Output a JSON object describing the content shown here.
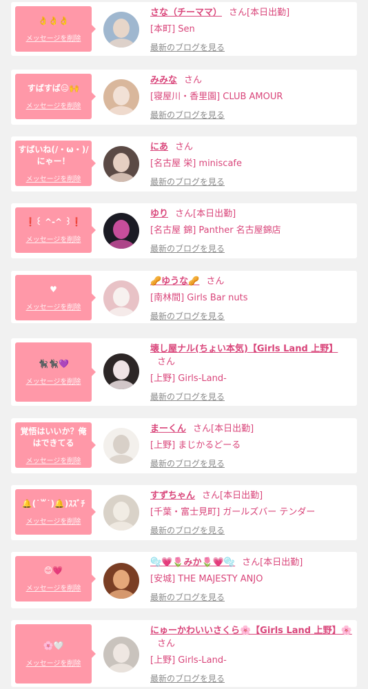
{
  "cards": [
    {
      "message": "👌👌👌",
      "delete_label": "メッセージを削除",
      "name": "さな（チーママ）",
      "san": "さん",
      "status": "[本日出勤]",
      "shop": "[本町] Sen",
      "blog_label": "最新のブログを見る"
    },
    {
      "message": "すばすば😑🙌",
      "delete_label": "メッセージを削除",
      "name": "みみな",
      "san": "さん",
      "status": "",
      "shop": "[寝屋川・香里園] CLUB AMOUR",
      "blog_label": "最新のブログを見る"
    },
    {
      "message": "すばいね(/・ω・)/にゃー！",
      "delete_label": "メッセージを削除",
      "name": "にあ",
      "san": "さん",
      "status": "",
      "shop": "[名古屋 栄] miniscafe",
      "blog_label": "最新のブログを見る"
    },
    {
      "message": "❗️꒰ ^-^ ꒱❗️",
      "delete_label": "メッセージを削除",
      "name": "ゆり",
      "san": "さん",
      "status": "[本日出勤]",
      "shop": "[名古屋 錦] Panther 名古屋錦店",
      "blog_label": "最新のブログを見る"
    },
    {
      "message": "♥",
      "delete_label": "メッセージを削除",
      "name": "🥜ゆうな🥜",
      "san": "さん",
      "status": "",
      "shop": "[南林間] Girls Bar nuts",
      "blog_label": "最新のブログを見る"
    },
    {
      "message": "🐈‍⬛🐈‍⬛💜",
      "delete_label": "メッセージを削除",
      "name": "壊し屋ナル(ちょい本気)【Girls Land 上野】",
      "san": "さん",
      "status": "",
      "shop": "[上野] Girls-Land-",
      "blog_label": "最新のブログを見る"
    },
    {
      "message": "覚悟はいいか？俺はできてる",
      "delete_label": "メッセージを削除",
      "name": "まーくん",
      "san": "さん",
      "status": "[本日出勤]",
      "shop": "[上野] まじかるどーる",
      "blog_label": "最新のブログを見る"
    },
    {
      "message": "🔔(˙꒳˙)🔔)ｽｽﾞﾁ",
      "delete_label": "メッセージを削除",
      "name": "すずちゃん",
      "san": "さん",
      "status": "[本日出勤]",
      "shop": "[千葉・富士見町] ガールズバー テンダー",
      "blog_label": "最新のブログを見る"
    },
    {
      "message": "😊💗",
      "delete_label": "メッセージを削除",
      "name": "🫧💗🌷みか🌷💗🫧",
      "san": "さん",
      "status": "[本日出勤]",
      "shop": "[安城] THE MAJESTY ANJO",
      "blog_label": "最新のブログを見る"
    },
    {
      "message": "🌸🤍",
      "delete_label": "メッセージを削除",
      "name": "にゅーかわいいさくら🌸【Girls Land 上野】🌸",
      "san": "さん",
      "status": "",
      "shop": "[上野] Girls-Land-",
      "blog_label": "最新のブログを見る"
    }
  ]
}
